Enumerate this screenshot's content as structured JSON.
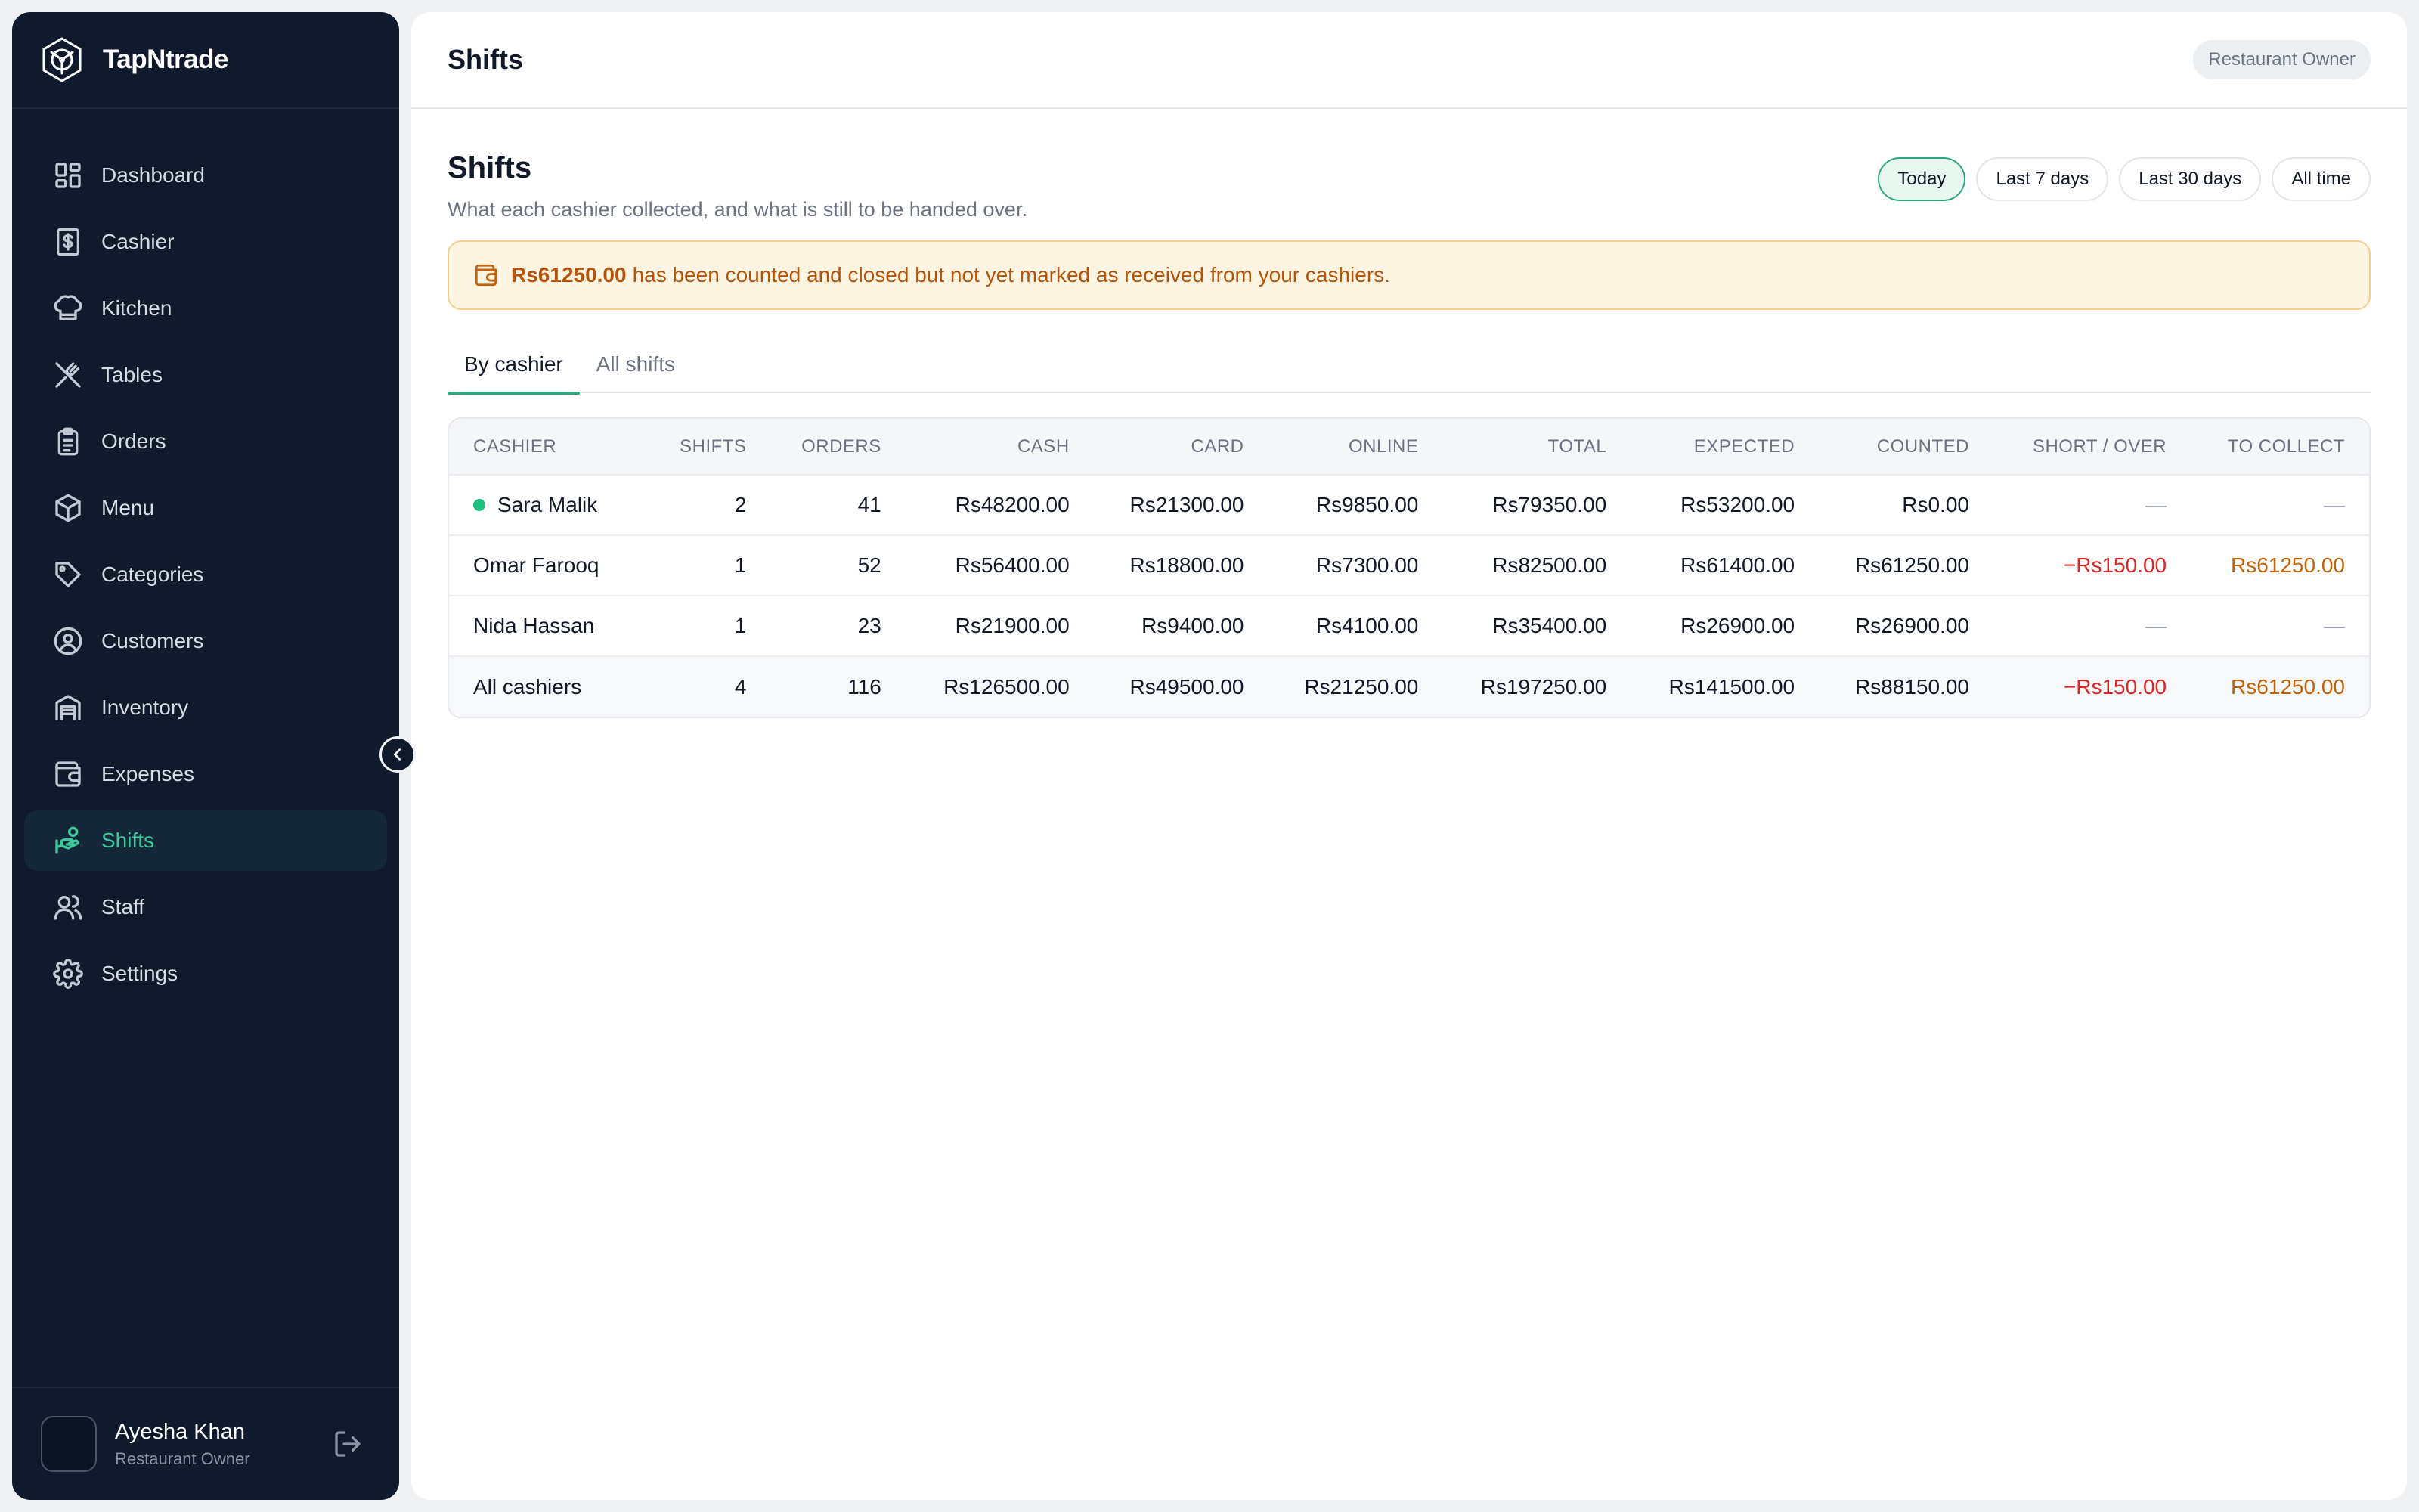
{
  "brand": {
    "name": "TapNtrade"
  },
  "nav": [
    {
      "label": "Dashboard",
      "icon": "dashboard-icon",
      "active": false
    },
    {
      "label": "Cashier",
      "icon": "cashier-icon",
      "active": false
    },
    {
      "label": "Kitchen",
      "icon": "chef-hat-icon",
      "active": false
    },
    {
      "label": "Tables",
      "icon": "utensils-icon",
      "active": false
    },
    {
      "label": "Orders",
      "icon": "clipboard-icon",
      "active": false
    },
    {
      "label": "Menu",
      "icon": "box-icon",
      "active": false
    },
    {
      "label": "Categories",
      "icon": "tag-icon",
      "active": false
    },
    {
      "label": "Customers",
      "icon": "user-circle-icon",
      "active": false
    },
    {
      "label": "Inventory",
      "icon": "warehouse-icon",
      "active": false
    },
    {
      "label": "Expenses",
      "icon": "wallet-icon",
      "active": false
    },
    {
      "label": "Shifts",
      "icon": "hand-coins-icon",
      "active": true
    },
    {
      "label": "Staff",
      "icon": "users-icon",
      "active": false
    },
    {
      "label": "Settings",
      "icon": "gear-icon",
      "active": false
    }
  ],
  "user": {
    "name": "Ayesha Khan",
    "role": "Restaurant Owner"
  },
  "topbar": {
    "title": "Shifts",
    "role_badge": "Restaurant Owner"
  },
  "page": {
    "title": "Shifts",
    "subtitle": "What each cashier collected, and what is still to be handed over."
  },
  "ranges": [
    "Today",
    "Last 7 days",
    "Last 30 days",
    "All time"
  ],
  "active_range": "Today",
  "alert": {
    "amount": "Rs61250.00",
    "text": "has been counted and closed but not yet marked as received from your cashiers."
  },
  "tabs": [
    "By cashier",
    "All shifts"
  ],
  "active_tab": "By cashier",
  "table": {
    "headers": [
      "CASHIER",
      "SHIFTS",
      "ORDERS",
      "CASH",
      "CARD",
      "ONLINE",
      "TOTAL",
      "EXPECTED",
      "COUNTED",
      "SHORT / OVER",
      "TO COLLECT"
    ],
    "rows": [
      {
        "cashier": "Sara Malik",
        "online_status": true,
        "shifts": "2",
        "orders": "41",
        "cash": "Rs48200.00",
        "card": "Rs21300.00",
        "online": "Rs9850.00",
        "total": "Rs79350.00",
        "expected": "Rs53200.00",
        "counted": "Rs0.00",
        "short_over": "—",
        "to_collect": "—"
      },
      {
        "cashier": "Omar Farooq",
        "online_status": false,
        "shifts": "1",
        "orders": "52",
        "cash": "Rs56400.00",
        "card": "Rs18800.00",
        "online": "Rs7300.00",
        "total": "Rs82500.00",
        "expected": "Rs61400.00",
        "counted": "Rs61250.00",
        "short_over": "−Rs150.00",
        "to_collect": "Rs61250.00"
      },
      {
        "cashier": "Nida Hassan",
        "online_status": false,
        "shifts": "1",
        "orders": "23",
        "cash": "Rs21900.00",
        "card": "Rs9400.00",
        "online": "Rs4100.00",
        "total": "Rs35400.00",
        "expected": "Rs26900.00",
        "counted": "Rs26900.00",
        "short_over": "—",
        "to_collect": "—"
      }
    ],
    "total_row": {
      "cashier": "All cashiers",
      "shifts": "4",
      "orders": "116",
      "cash": "Rs126500.00",
      "card": "Rs49500.00",
      "online": "Rs21250.00",
      "total": "Rs197250.00",
      "expected": "Rs141500.00",
      "counted": "Rs88150.00",
      "short_over": "−Rs150.00",
      "to_collect": "Rs61250.00"
    }
  },
  "colors": {
    "sidebar_bg": "#111a2c",
    "accent_green": "#3ec99b",
    "short_red": "#dc2626",
    "collect_orange": "#c2620a",
    "alert_bg": "#fef4e2"
  }
}
